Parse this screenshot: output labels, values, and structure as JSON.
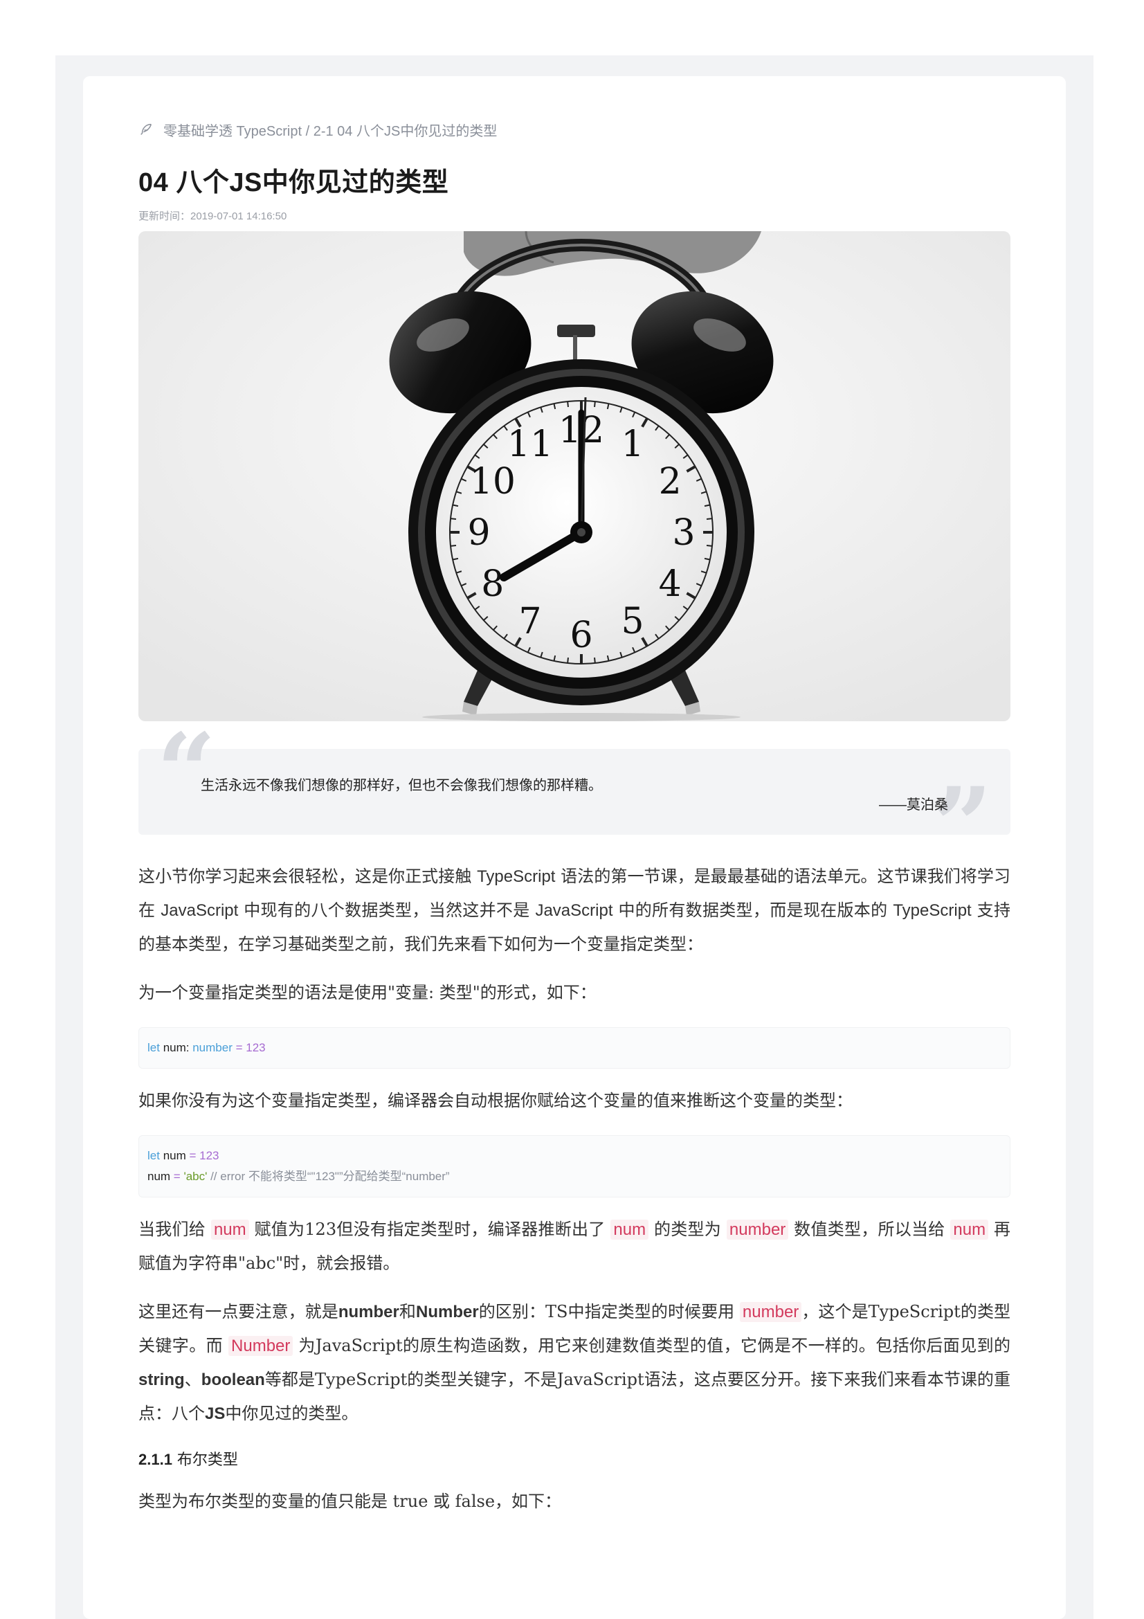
{
  "breadcrumb": {
    "icon": "feather-icon",
    "text": "零基础学透 TypeScript / 2-1 04 八个JS中你见过的类型"
  },
  "article": {
    "title": "04 八个JS中你见过的类型",
    "updated": "更新时间：2019-07-01 14:16:50"
  },
  "hero": {
    "alt": "alarm-clock-photo",
    "clock_numbers": [
      "12",
      "1",
      "2",
      "3",
      "4",
      "5",
      "6",
      "7",
      "8",
      "9",
      "10",
      "11"
    ]
  },
  "quote": {
    "text": "生活永远不像我们想像的那样好，但也不会像我们想像的那样糟。",
    "author": "——莫泊桑"
  },
  "paragraphs": {
    "intro_a": "这小节你学习起来会很轻松，这是你正式接触 ",
    "intro_ts1": "TypeScript",
    "intro_b": " 语法的第一节课，是最最基础的语法单元。这节课我们将学习在 ",
    "intro_js1": "JavaScript",
    "intro_c": " 中现有的八个数据类型，当然这并不是 ",
    "intro_js2": "JavaScript",
    "intro_d": " 中的所有数据类型，而是现在版本的 ",
    "intro_ts2": "TypeScript",
    "intro_e": " 支持的基本类型，在学习基础类型之前，我们先来看下如何为一个变量指定类型：",
    "syntax": "为一个变量指定类型的语法是使用\"变量: 类型\"的形式，如下：",
    "infer": "如果你没有为这个变量指定类型，编译器会自动根据你赋给这个变量的值来推断这个变量的类型：",
    "explain_a": "当我们给 ",
    "explain_num1": "num",
    "explain_b": " 赋值为123但没有指定类型时，编译器推断出了 ",
    "explain_num2": "num",
    "explain_c": " 的类型为 ",
    "explain_number": "number",
    "explain_d": " 数值类型，所以当给 ",
    "explain_num3": "num",
    "explain_e": " 再赋值为字符串\"abc\"时，就会报错。",
    "note_a": "这里还有一点要注意，就是",
    "note_number_b": "number",
    "note_b": "和",
    "note_Number_b": "Number",
    "note_c": "的区别：TS中指定类型的时候要用 ",
    "note_number_code": "number",
    "note_d": "，这个是TypeScript的类型关键字。而 ",
    "note_Number_code": "Number",
    "note_e": " 为JavaScript的原生构造函数，用它来创建数值类型的值，它俩是不一样的。包括你后面见到的",
    "note_string": "string",
    "note_f": "、",
    "note_boolean": "boolean",
    "note_g": "等都是TypeScript的类型关键字，不是JavaScript语法，这点要区分开。接下来我们来看本节课的重点：八个",
    "note_js": "JS",
    "note_h": "中你见过的类型。",
    "section_num": "2.1.1",
    "section_title": " 布尔类型",
    "bool_intro": "类型为布尔类型的变量的值只能是 true 或 false，如下："
  },
  "code1": {
    "kw": "let",
    "name": " num",
    "colon": ": ",
    "type": "number",
    "eq": " = ",
    "val": "123"
  },
  "code2": {
    "l1_kw": "let",
    "l1_name": " num",
    "l1_eq": " = ",
    "l1_val": "123",
    "l2_name": "num",
    "l2_eq": " = ",
    "l2_str": "'abc'",
    "l2_comment": " // error 不能将类型“\"123\"”分配给类型“number”"
  }
}
